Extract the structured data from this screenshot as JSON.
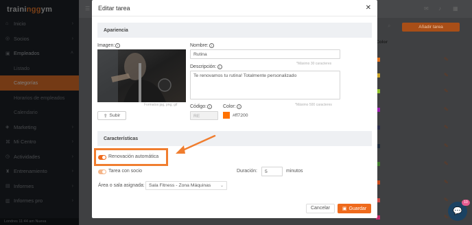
{
  "app": {
    "brand": "traininggym"
  },
  "sidebar": {
    "items": [
      {
        "label": "Inicio",
        "icon": "home-icon"
      },
      {
        "label": "Socios",
        "icon": "users-icon"
      },
      {
        "label": "Empleados",
        "icon": "employees-icon"
      },
      {
        "label": "Marketing",
        "icon": "marketing-icon"
      },
      {
        "label": "Mi Centro",
        "icon": "center-icon"
      },
      {
        "label": "Actividades",
        "icon": "activities-icon"
      },
      {
        "label": "Entrenamiento",
        "icon": "training-icon"
      },
      {
        "label": "Informes",
        "icon": "reports-icon"
      },
      {
        "label": "Informes pro",
        "icon": "reports-pro-icon"
      }
    ],
    "subitems": [
      "Listado",
      "Categorías",
      "Horarios de empleados",
      "Calendario"
    ],
    "status": "Londres 11:44 am  Nueva"
  },
  "background": {
    "add_button": "Añadir tarea",
    "color_column": "Color",
    "swatch_colors": [
      "#e0711d",
      "#c9a227",
      "#8fbf2a",
      "#9b1fb0",
      "#2b2d4a",
      "#1e2a3a",
      "#3f7a2e",
      "#c44a1d",
      "#d14b47",
      "#c42a6b"
    ]
  },
  "modal": {
    "title": "Editar tarea",
    "section_appearance": "Apariencia",
    "image_label": "Imagen:",
    "image_hint": "Formatos jpg, png, gif",
    "upload_label": "Subir",
    "name_label": "Nombre:",
    "name_value": "Rutina",
    "name_hint": "*Máximo 30 caracteres",
    "description_label": "Descripción:",
    "description_value": "Te renovamos tu rutina! Totalmente personalizado",
    "description_hint": "*Máximo 500 caracteres",
    "code_label": "Código:",
    "code_value": "RE",
    "color_label": "Color:",
    "color_value": "#ff7200",
    "section_features": "Características",
    "auto_renew_label": "Renovación automática",
    "with_member_label": "Tarea con socio",
    "duration_label": "Duración:",
    "duration_value": "5",
    "duration_unit": "minutos",
    "area_label": "Área o sala asignada:",
    "area_value": "Sala Fitness - Zona Máquinas",
    "cancel_label": "Cancelar",
    "save_label": "Guardar"
  },
  "chat": {
    "badge": "10"
  }
}
